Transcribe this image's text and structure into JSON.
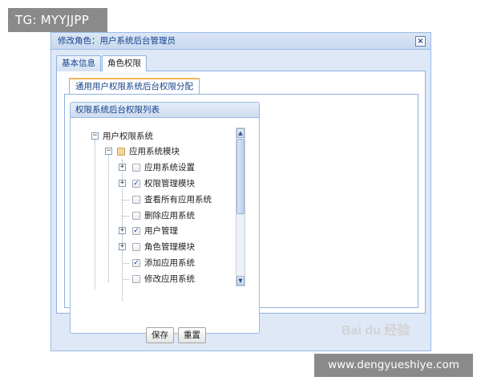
{
  "overlay": {
    "tg_label": "TG: MYYJJPP",
    "url_label": "www.dengyueshiye.com",
    "watermark": "Bai du 经验"
  },
  "dialog": {
    "title": "修改角色：用户系统后台管理员",
    "close_icon": "close-icon",
    "tabs": [
      {
        "label": "基本信息",
        "active": false
      },
      {
        "label": "角色权限",
        "active": true
      }
    ],
    "subtab_label": "通用用户权限系统后台权限分配",
    "panel_title": "权限系统后台权限列表",
    "buttons": {
      "save": "保存",
      "reset": "重置"
    }
  },
  "tree": {
    "root": {
      "label": "用户权限系统",
      "expanded": true
    },
    "module": {
      "label": "应用系统模块",
      "expanded": true,
      "check": "partial"
    },
    "items": [
      {
        "label": "应用系统设置",
        "expandable": true,
        "checked": false
      },
      {
        "label": "权限管理模块",
        "expandable": true,
        "checked": true
      },
      {
        "label": "查看所有应用系统",
        "expandable": false,
        "checked": false
      },
      {
        "label": "删除应用系统",
        "expandable": false,
        "checked": false
      },
      {
        "label": "用户管理",
        "expandable": true,
        "checked": true
      },
      {
        "label": "角色管理模块",
        "expandable": true,
        "checked": false
      },
      {
        "label": "添加应用系统",
        "expandable": false,
        "checked": true
      },
      {
        "label": "修改应用系统",
        "expandable": false,
        "checked": false
      }
    ]
  },
  "colors": {
    "header_blue": "#15428b",
    "border_blue": "#99bbe8",
    "dialog_bg": "#dfe8f6",
    "tab_accent": "#f3b657"
  }
}
